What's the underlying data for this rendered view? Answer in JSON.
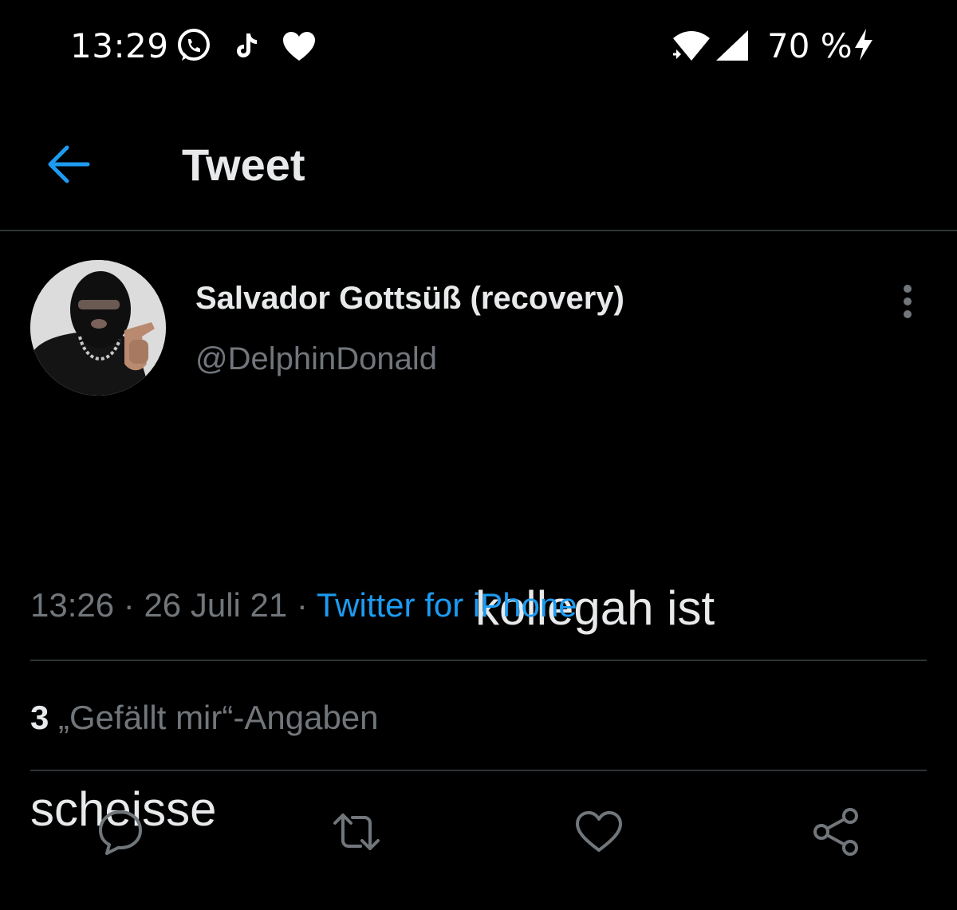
{
  "status_bar": {
    "time": "13:29",
    "battery": "70 %",
    "icons": [
      "whatsapp-icon",
      "tiktok-icon",
      "heart-icon",
      "wifi-icon",
      "signal-icon",
      "charging-icon"
    ]
  },
  "header": {
    "title": "Tweet",
    "back_icon": "arrow-left-icon"
  },
  "tweet": {
    "display_name": "Salvador Gottsüß (recovery)",
    "handle": "@DelphinDonald",
    "text_line_1": "kollegah ist",
    "text_line_2": "scheisse",
    "time": "13:26",
    "separator": "·",
    "date": "26 Juli 21",
    "source": "Twitter for iPhone",
    "likes_count": "3",
    "likes_label": "„Gefällt mir“-Angaben"
  },
  "actions": [
    "reply-icon",
    "retweet-icon",
    "like-icon",
    "share-icon"
  ],
  "colors": {
    "background": "#000000",
    "text": "#e7e9ea",
    "secondary_text": "#71767b",
    "accent": "#1d9bf0",
    "divider": "#2f3336"
  }
}
